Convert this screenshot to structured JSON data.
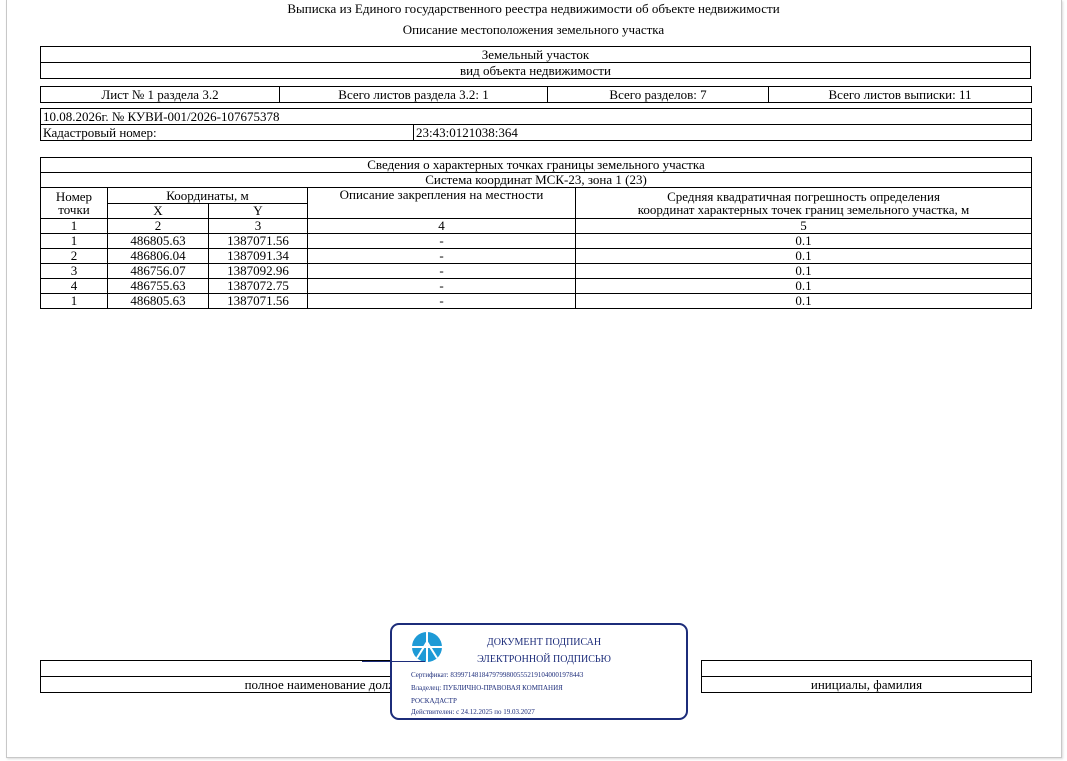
{
  "header": {
    "title": "Выписка из Единого государственного реестра недвижимости об объекте недвижимости",
    "subtitle": "Описание местоположения земельного участка"
  },
  "object": {
    "type": "Земельный участок",
    "type_caption": "вид объекта недвижимости"
  },
  "sheets": {
    "sheet": "Лист № 1 раздела 3.2",
    "section_sheets": "Всего листов раздела 3.2: 1",
    "sections": "Всего разделов: 7",
    "total_sheets": "Всего листов выписки: 11"
  },
  "document": {
    "date_number": "10.08.2026г. № КУВИ-001/2026-107675378",
    "cadastral_label": "Кадастровый номер:",
    "cadastral_value": "23:43:0121038:364"
  },
  "points": {
    "title": "Сведения о характерных точках границы земельного участка",
    "system": "Система координат МСК-23, зона 1 (23)",
    "col_number_1": "Номер",
    "col_number_2": "точки",
    "col_coords": "Координаты, м",
    "col_x": "X",
    "col_y": "Y",
    "col_description": "Описание закрепления на местности",
    "col_error_1": "Средняя квадратичная погрешность определения",
    "col_error_2": "координат характерных точек границ земельного участка, м",
    "index": [
      "1",
      "2",
      "3",
      "4",
      "5"
    ],
    "rows": [
      {
        "n": "1",
        "x": "486805.63",
        "y": "1387071.56",
        "desc": "-",
        "err": "0.1"
      },
      {
        "n": "2",
        "x": "486806.04",
        "y": "1387091.34",
        "desc": "-",
        "err": "0.1"
      },
      {
        "n": "3",
        "x": "486756.07",
        "y": "1387092.96",
        "desc": "-",
        "err": "0.1"
      },
      {
        "n": "4",
        "x": "486755.63",
        "y": "1387072.75",
        "desc": "-",
        "err": "0.1"
      },
      {
        "n": "1",
        "x": "486805.63",
        "y": "1387071.56",
        "desc": "-",
        "err": "0.1"
      }
    ]
  },
  "signature": {
    "position_caption": "полное наименование должности",
    "name_caption": "инициалы, фамилия"
  },
  "stamp": {
    "line1": "ДОКУМЕНТ ПОДПИСАН",
    "line2": "ЭЛЕКТРОННОЙ ПОДПИСЬЮ",
    "certificate": "Сертификат: 83997148184797998005552191040001978443",
    "owner": "Владелец: ПУБЛИЧНО-ПРАВОВАЯ КОМПАНИЯ",
    "owner2": "РОСКАДАСТР",
    "valid": "Действителен: с 24.12.2025 по 19.03.2027",
    "color": "#1c2c7a",
    "logo_color": "#1e9ad6"
  }
}
